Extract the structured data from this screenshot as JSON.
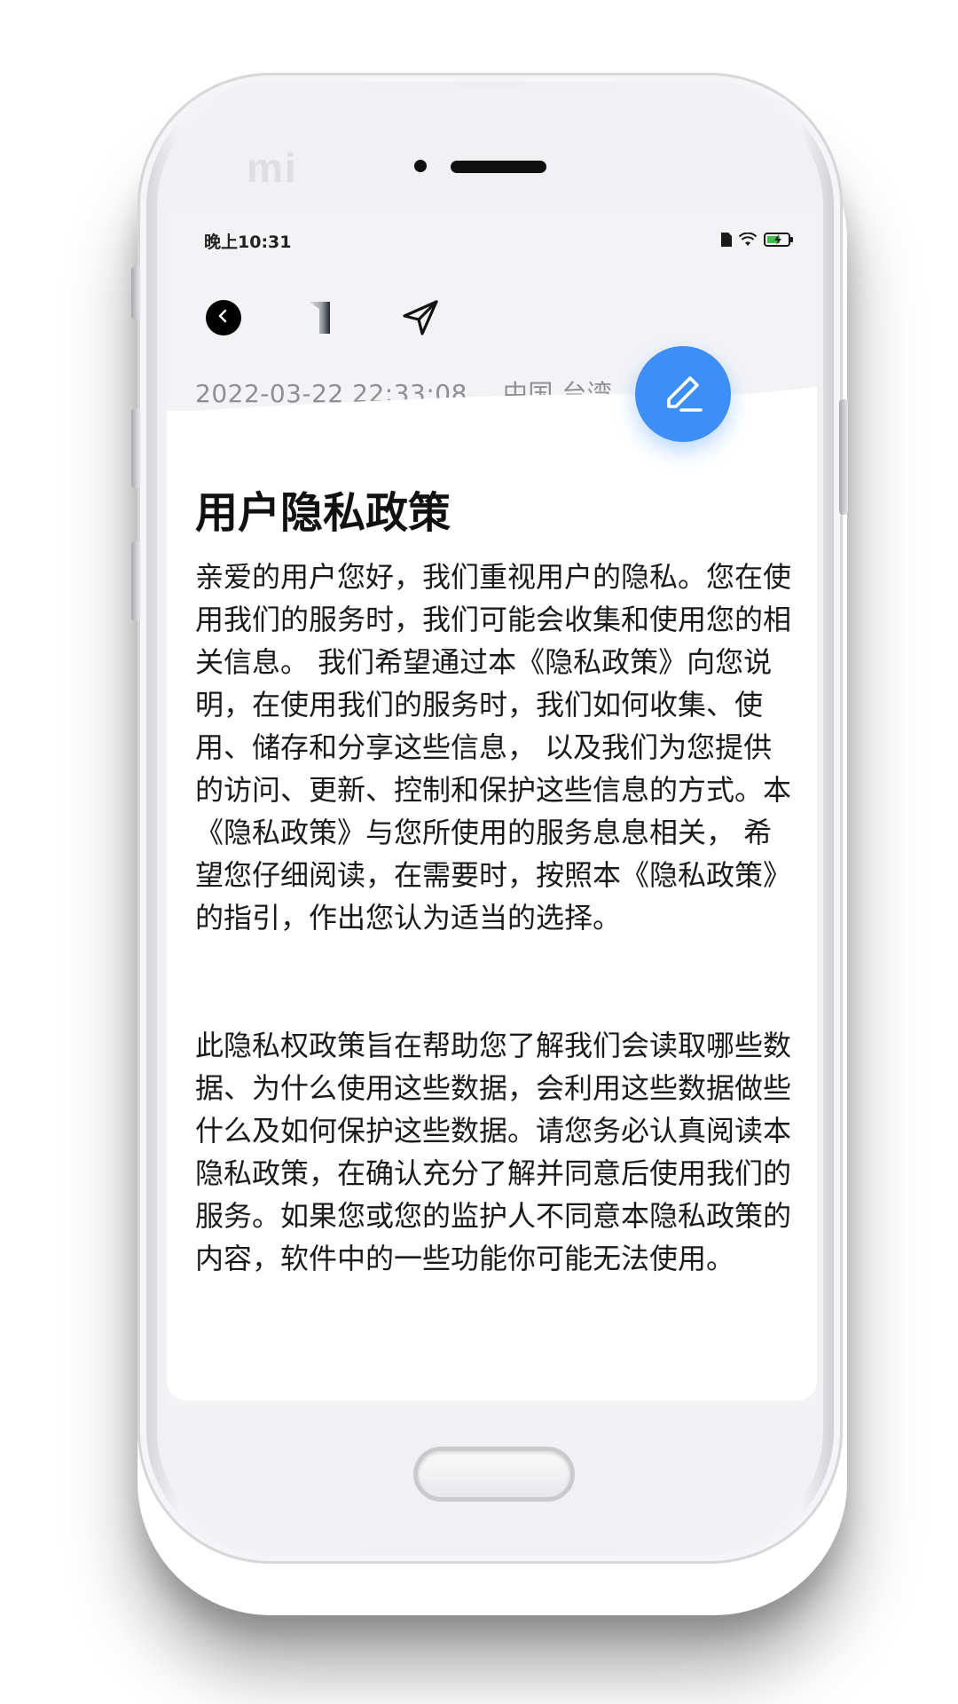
{
  "status_bar": {
    "time": "晚上10:31",
    "icons": [
      "sim-icon",
      "wifi-icon",
      "battery-charging-icon"
    ]
  },
  "device": {
    "brand_logo": "mi"
  },
  "toolbar": {
    "back_icon": "back-icon",
    "bookmark_icon": "bookmark-icon",
    "share_icon": "send-icon"
  },
  "meta": {
    "date": "2022-03-22 22:33:08",
    "location": "中国 台湾"
  },
  "fab": {
    "icon": "edit-icon",
    "color": "#3d8ef7"
  },
  "document": {
    "title": "用户隐私政策",
    "paragraphs": [
      "亲爱的用户您好，我们重视用户的隐私。您在使用我们的服务时，我们可能会收集和使用您的相关信息。 我们希望通过本《隐私政策》向您说明，在使用我们的服务时，我们如何收集、使用、储存和分享这些信息， 以及我们为您提供的访问、更新、控制和保护这些信息的方式。本《隐私政策》与您所使用的服务息息相关， 希望您仔细阅读，在需要时，按照本《隐私政策》的指引，作出您认为适当的选择。",
      "此隐私权政策旨在帮助您了解我们会读取哪些数据、为什么使用这些数据，会利用这些数据做些什么及如何保护这些数据。请您务必认真阅读本隐私政策，在确认充分了解并同意后使用我们的服务。如果您或您的监护人不同意本隐私政策的内容，软件中的一些功能你可能无法使用。"
    ]
  }
}
